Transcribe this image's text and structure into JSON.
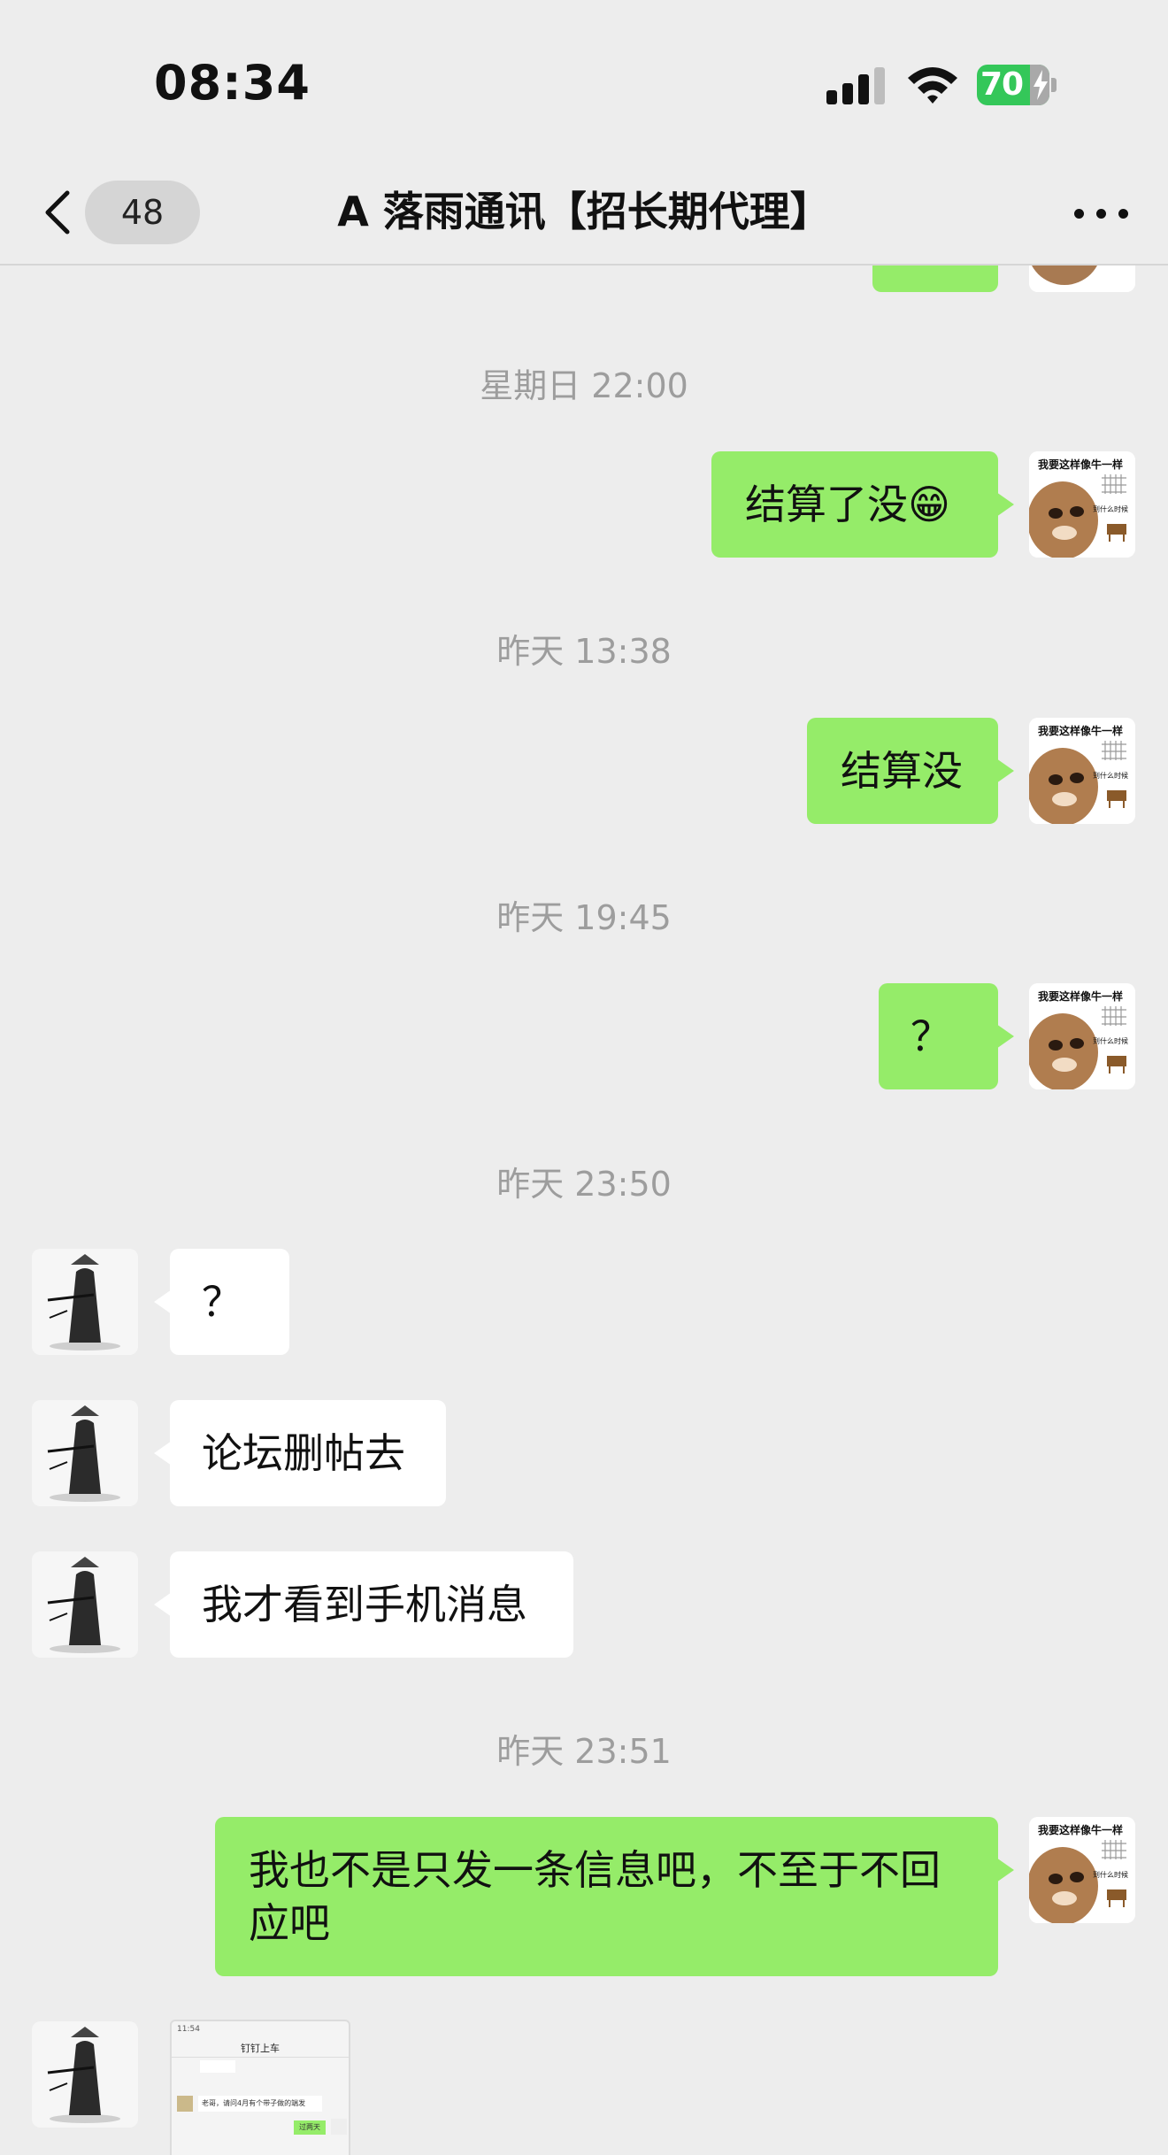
{
  "status_bar": {
    "time": "08:34",
    "battery_level": "70",
    "signal_icon": "cellular-signal-icon",
    "wifi_icon": "wifi-icon"
  },
  "header": {
    "back_icon": "chevron-left-icon",
    "unread_count": "48",
    "title": "A 落雨通讯【招长期代理】",
    "more_icon": "more-dots-icon"
  },
  "colors": {
    "background": "#ededed",
    "my_bubble": "#95ec69",
    "other_bubble": "#ffffff",
    "timestamp_text": "#9d9d9d",
    "battery": "#34c759"
  },
  "my_avatar": {
    "caption": "我要这样像牛一样",
    "caption_small": "到什么时候"
  },
  "timestamps": [
    "星期日 22:00",
    "昨天 13:38",
    "昨天 19:45",
    "昨天 23:50",
    "昨天 23:51"
  ],
  "messages": [
    {
      "from": "me",
      "text": "结算了没😁"
    },
    {
      "from": "me",
      "text": "结算没"
    },
    {
      "from": "me",
      "text": "？"
    },
    {
      "from": "other",
      "text": "？"
    },
    {
      "from": "other",
      "text": "论坛删帖去"
    },
    {
      "from": "other",
      "text": "我才看到手机消息"
    },
    {
      "from": "me",
      "text": "我也不是只发一条信息吧，不至于不回应吧"
    }
  ],
  "screenshot_message": {
    "from": "other",
    "mini_title": "钉钉上车",
    "mini_status": "11:54",
    "mini_text": "老哥，请问4月有个带子做的端发",
    "mini_reply": "过两天"
  }
}
